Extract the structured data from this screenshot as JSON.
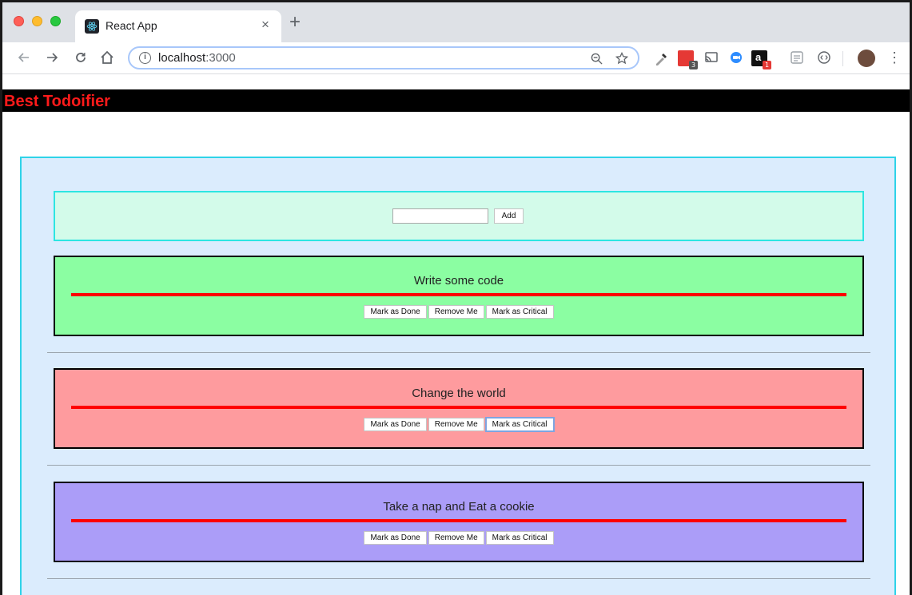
{
  "browser": {
    "tab_title": "React App",
    "tab_close": "×",
    "new_tab": "+",
    "url_host": "localhost",
    "url_port": ":3000",
    "extensions": [
      {
        "name": "eyedropper-extension-icon",
        "badge": ""
      },
      {
        "name": "calendar-extension-icon",
        "badge": "3"
      },
      {
        "name": "cast-icon",
        "badge": ""
      },
      {
        "name": "zoom-extension-icon",
        "badge": ""
      },
      {
        "name": "amazon-extension-icon",
        "badge": "1"
      },
      {
        "name": "pdf-extension-icon",
        "badge": ""
      },
      {
        "name": "code-extension-icon",
        "badge": ""
      }
    ]
  },
  "app": {
    "title": "Best Todoifier",
    "add_button": "Add",
    "add_input_value": "",
    "todos": [
      {
        "text": "Write some code",
        "color": "#8bfea2",
        "done": "Mark as Done",
        "remove": "Remove Me",
        "critical": "Mark as Critical"
      },
      {
        "text": "Change the world",
        "color": "#fe9b9e",
        "done": "Mark as Done",
        "remove": "Remove Me",
        "critical": "Mark as Critical"
      },
      {
        "text": "Take a nap and Eat a cookie",
        "color": "#ab9df8",
        "done": "Mark as Done",
        "remove": "Remove Me",
        "critical": "Mark as Critical"
      }
    ]
  }
}
